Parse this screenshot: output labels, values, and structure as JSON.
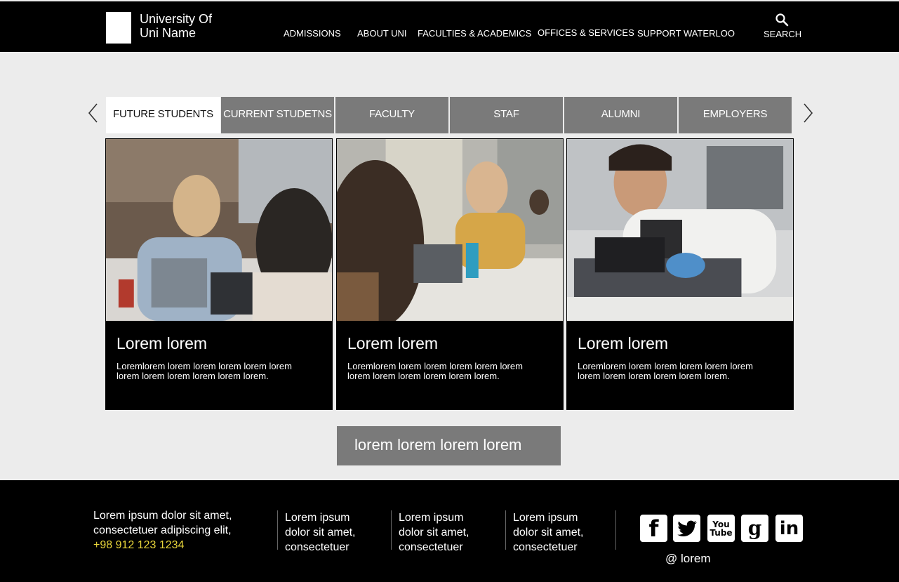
{
  "header": {
    "logo_line1": "University Of",
    "logo_line2": "Uni Name",
    "nav": [
      "ADMISSIONS",
      "ABOUT UNI",
      "FACULTIES & ACADEMICS",
      "OFFICES & SERVICES",
      "SUPPORT WATERLOO"
    ],
    "search_label": "SEARCH",
    "search_icon": "search-icon"
  },
  "tabs": {
    "items": [
      "FUTURE STUDENTS",
      "CURRENT STUDETNS",
      "FACULTY",
      "STAF",
      "ALUMNI",
      "EMPLOYERS"
    ],
    "active": "FUTURE STUDENTS",
    "prev_icon": "chevron-left-icon",
    "next_icon": "chevron-right-icon"
  },
  "cards": [
    {
      "title": "Lorem lorem",
      "desc": "Loremlorem lorem lorem lorem lorem lorem lorem lorem lorem lorem lorem lorem."
    },
    {
      "title": "Lorem lorem",
      "desc": "Loremlorem lorem lorem lorem lorem lorem lorem lorem lorem lorem lorem lorem."
    },
    {
      "title": "Lorem lorem",
      "desc": "Loremlorem lorem lorem lorem lorem lorem lorem lorem lorem lorem lorem lorem."
    }
  ],
  "cta_label": "lorem lorem lorem lorem",
  "footer": {
    "main_line1": "Lorem ipsum dolor sit amet,",
    "main_line2": "consectetuer adipiscing elit,",
    "phone": "+98 912 123 1234",
    "columns": [
      {
        "line1": "Lorem ipsum",
        "line2": "dolor sit amet,",
        "line3": "consectetuer"
      },
      {
        "line1": "Lorem ipsum",
        "line2": "dolor sit amet,",
        "line3": "consectetuer"
      },
      {
        "line1": "Lorem ipsum",
        "line2": "dolor sit amet,",
        "line3": "consectetuer"
      }
    ],
    "social": [
      "facebook-icon",
      "twitter-icon",
      "youtube-icon",
      "google-icon",
      "linkedin-icon"
    ],
    "handle": "@ lorem"
  },
  "colors": {
    "header_bg": "#000000",
    "tab_bg": "#7a7a7a",
    "phone": "#e8d53a"
  }
}
